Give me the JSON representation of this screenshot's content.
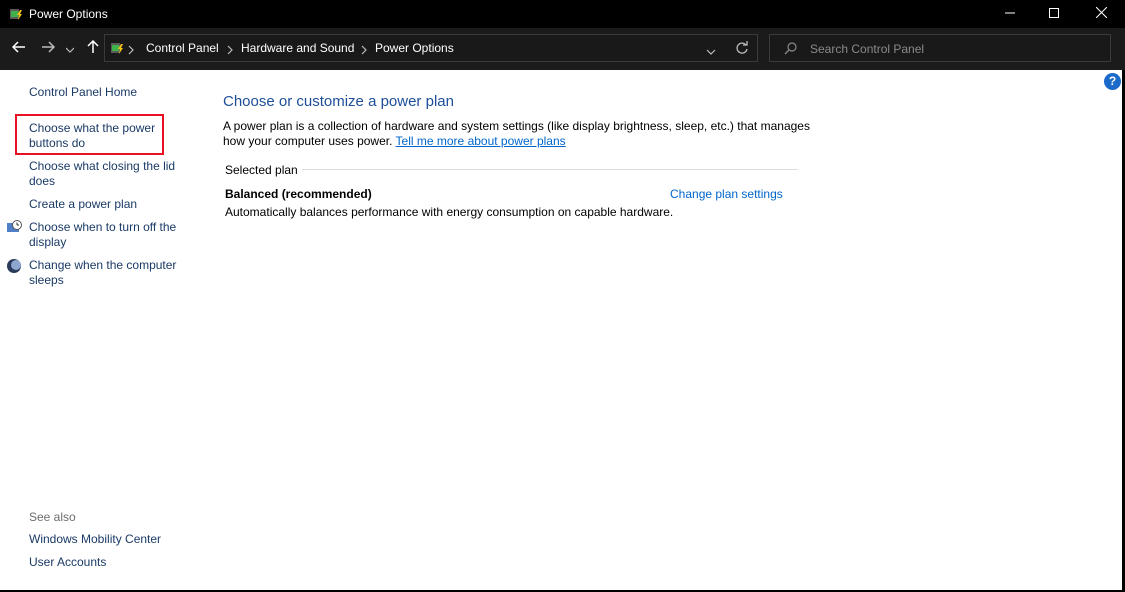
{
  "window": {
    "title": "Power Options",
    "minimize_icon": "minimize-icon",
    "maximize_icon": "maximize-icon",
    "close_icon": "close-icon"
  },
  "address": {
    "crumbs": [
      "Control Panel",
      "Hardware and Sound",
      "Power Options"
    ]
  },
  "search": {
    "placeholder": "Search Control Panel"
  },
  "sidebar": {
    "home": "Control Panel Home",
    "items": [
      {
        "label_1": "Choose what the power",
        "label_2": "buttons do"
      },
      {
        "label_1": "Choose what closing the lid",
        "label_2": "does"
      },
      {
        "label_1": "Create a power plan"
      },
      {
        "label_1": "Choose when to turn off the",
        "label_2": "display",
        "icon": "display-schedule-icon"
      },
      {
        "label_1": "Change when the computer",
        "label_2": "sleeps",
        "icon": "sleep-moon-icon"
      }
    ],
    "see_also": "See also",
    "see_also_links": [
      "Windows Mobility Center",
      "User Accounts"
    ]
  },
  "main": {
    "heading": "Choose or customize a power plan",
    "desc_line1": "A power plan is a collection of hardware and system settings (like display brightness, sleep, etc.) that manages",
    "desc_line2": "how your computer uses power.",
    "desc_link": "Tell me more about power plans",
    "selected_plan_label": "Selected plan",
    "plan_name": "Balanced (recommended)",
    "plan_desc": "Automatically balances performance with energy consumption on capable hardware.",
    "plan_link": "Change plan settings"
  },
  "help": {
    "label": "?"
  },
  "colors": {
    "accent_heading": "#1e4e9a",
    "link": "#0066cc",
    "highlight": "#e81123"
  }
}
